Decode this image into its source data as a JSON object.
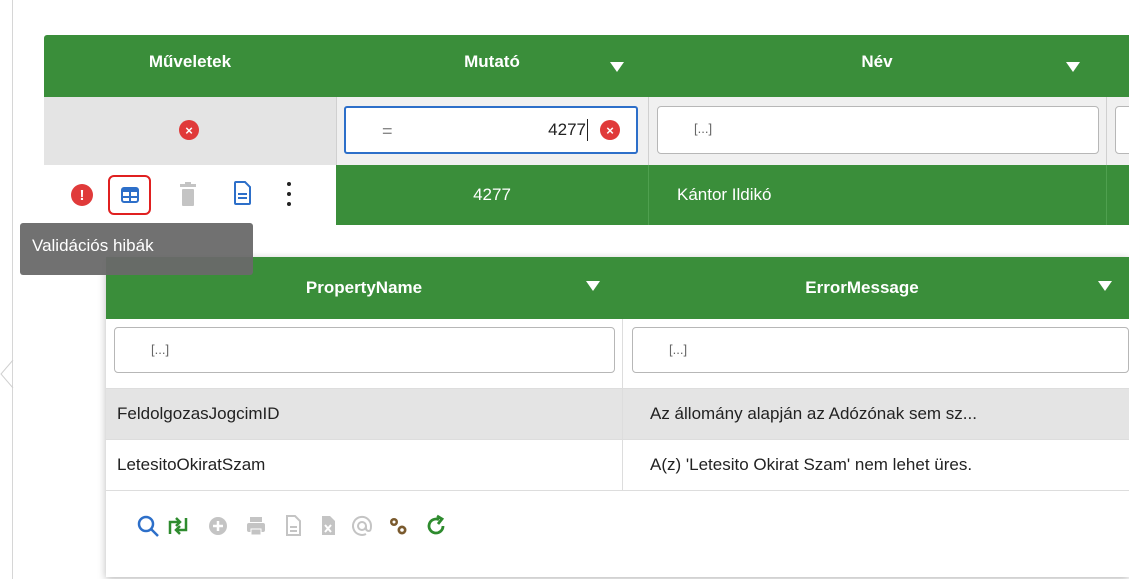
{
  "columns": {
    "operations": "Műveletek",
    "index": "Mutató",
    "name": "Név"
  },
  "filters": {
    "index_operator": "=",
    "index_value": "4277",
    "name_placeholder": "[...]"
  },
  "row": {
    "index": "4277",
    "name": "Kántor Ildikó"
  },
  "tooltip": "Validációs hibák",
  "detail": {
    "columns": {
      "property": "PropertyName",
      "message": "ErrorMessage"
    },
    "filter_placeholder": "[...]",
    "rows": [
      {
        "property": "FeldolgozasJogcimID",
        "message": "Az állomány alapján az Adózónak sem sz..."
      },
      {
        "property": "LetesitoOkiratSzam",
        "message": "A(z) 'Letesito Okirat Szam' nem lehet üres."
      }
    ],
    "toolbar": [
      "search-icon",
      "refresh-columns-icon",
      "add-icon",
      "print-icon",
      "export-doc-icon",
      "export-excel-icon",
      "email-icon",
      "settings-icon",
      "reload-icon"
    ]
  },
  "colors": {
    "header_green": "#3a8e3a",
    "error_red": "#e03a3a",
    "highlight_red": "#e02020",
    "icon_blue": "#2d6fc9",
    "tooltip_gray": "#6a6a6a"
  }
}
